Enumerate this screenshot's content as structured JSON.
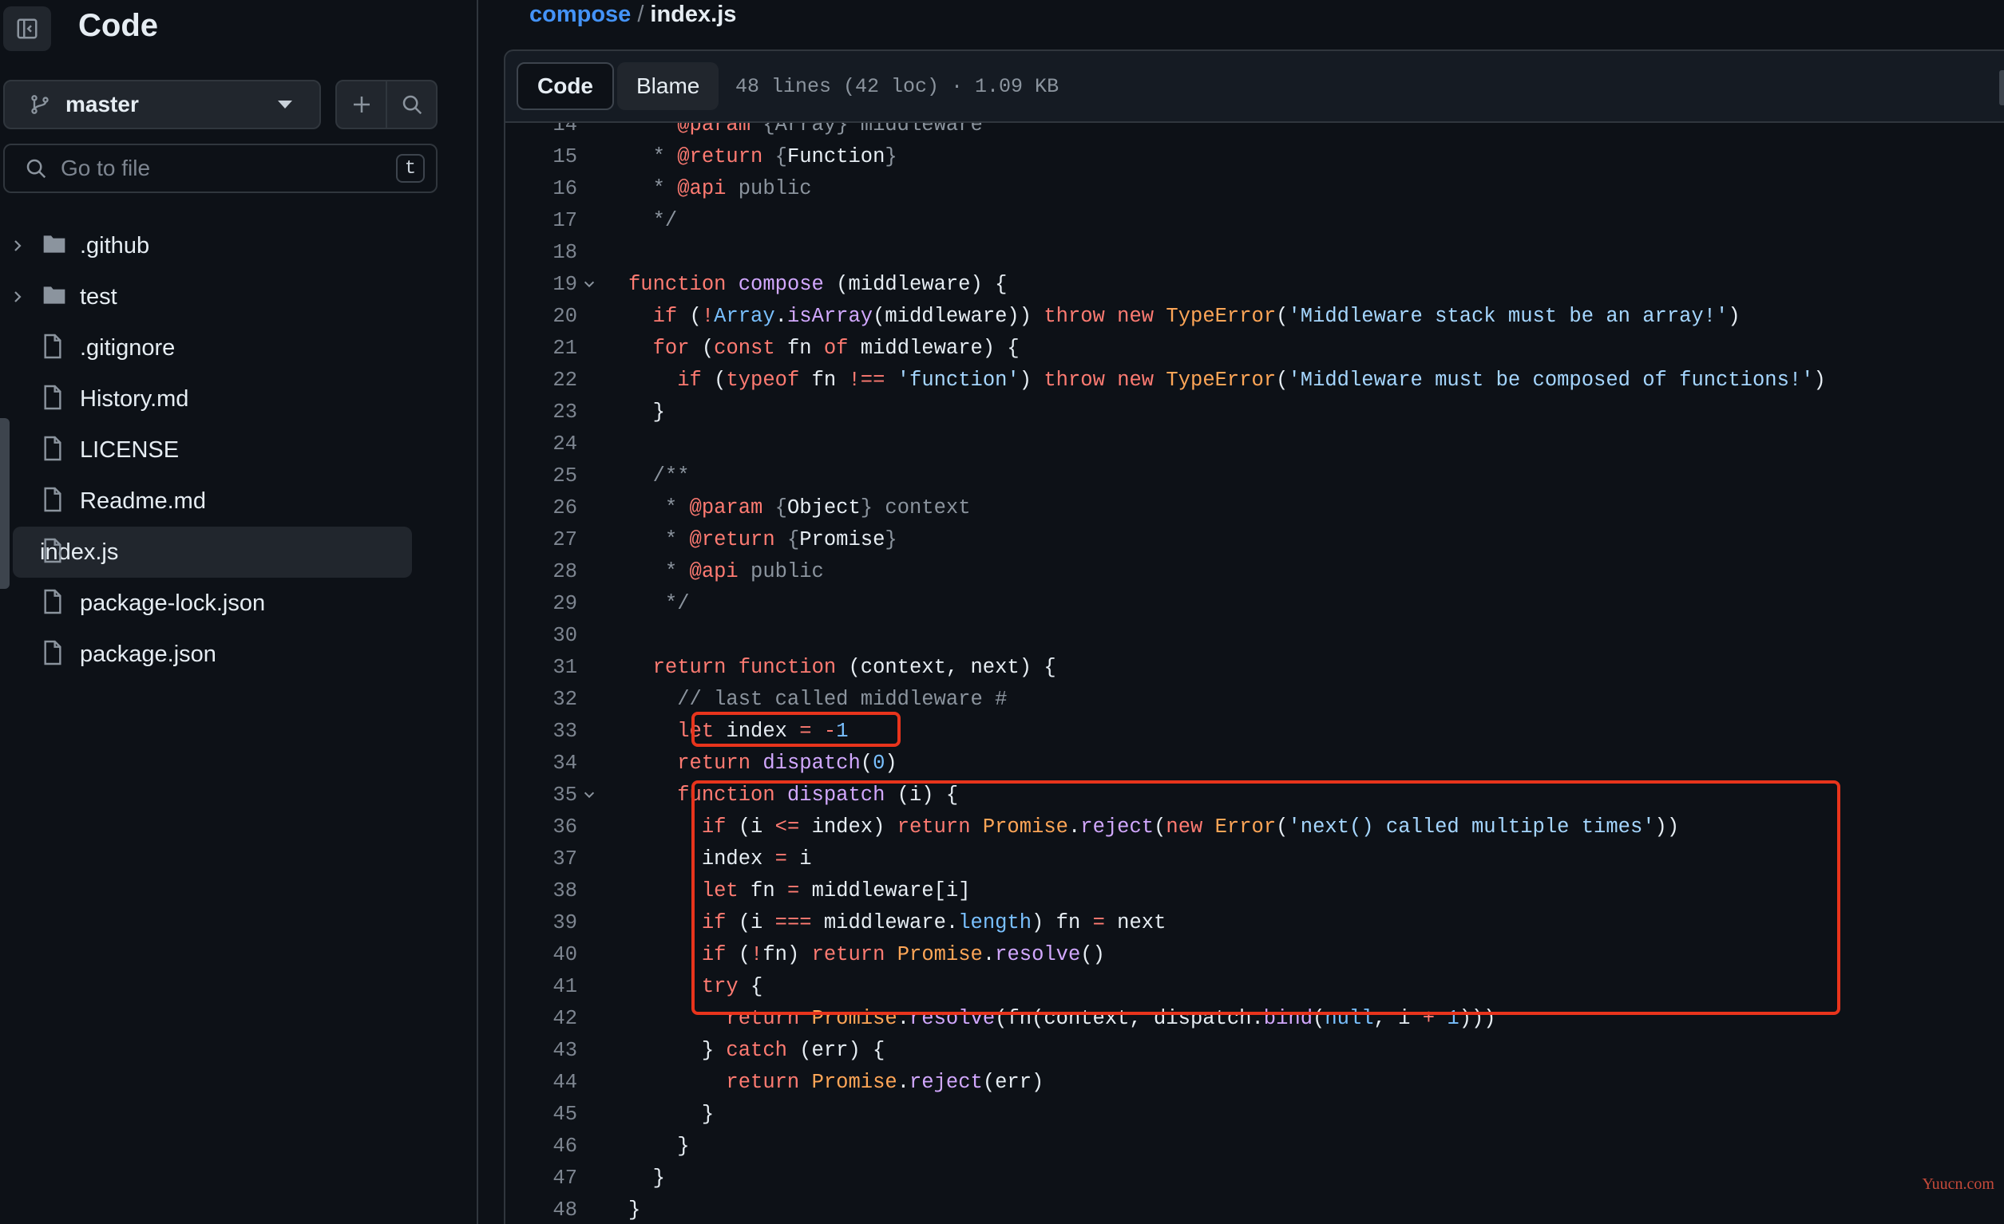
{
  "sidebar": {
    "title": "Code",
    "branch": "master",
    "goto_placeholder": "Go to file",
    "goto_shortcut": "t",
    "items": [
      {
        "name": ".github",
        "type": "folder",
        "expandable": true
      },
      {
        "name": "test",
        "type": "folder",
        "expandable": true
      },
      {
        "name": ".gitignore",
        "type": "file"
      },
      {
        "name": "History.md",
        "type": "file"
      },
      {
        "name": "LICENSE",
        "type": "file"
      },
      {
        "name": "Readme.md",
        "type": "file"
      },
      {
        "name": "index.js",
        "type": "file",
        "selected": true
      },
      {
        "name": "package-lock.json",
        "type": "file"
      },
      {
        "name": "package.json",
        "type": "file"
      }
    ]
  },
  "breadcrumb": {
    "repo": "compose",
    "separator": "/",
    "file": "index.js"
  },
  "file_header": {
    "tabs": [
      "Code",
      "Blame"
    ],
    "active_tab": "Code",
    "meta": "48 lines (42 loc) · 1.09 KB"
  },
  "code": {
    "lines": [
      {
        "n": "14",
        "tokens": [
          [
            "cm",
            "  * "
          ],
          [
            "kw",
            "@param"
          ],
          [
            "cm",
            " {Array} middleware"
          ]
        ]
      },
      {
        "n": "15",
        "tokens": [
          [
            "cm",
            "  * "
          ],
          [
            "kw",
            "@return"
          ],
          [
            "cm",
            " {"
          ],
          [
            "pl",
            "Function"
          ],
          [
            "cm",
            "}"
          ]
        ]
      },
      {
        "n": "16",
        "tokens": [
          [
            "cm",
            "  * "
          ],
          [
            "kw",
            "@api"
          ],
          [
            "cm",
            " public"
          ]
        ]
      },
      {
        "n": "17",
        "tokens": [
          [
            "cm",
            "  */"
          ]
        ]
      },
      {
        "n": "18",
        "tokens": []
      },
      {
        "n": "19",
        "fold": true,
        "tokens": [
          [
            "kw",
            "function"
          ],
          [
            "pl",
            " "
          ],
          [
            "fn",
            "compose"
          ],
          [
            "pl",
            " (middleware) {"
          ]
        ]
      },
      {
        "n": "20",
        "tokens": [
          [
            "pl",
            "  "
          ],
          [
            "kw",
            "if"
          ],
          [
            "pl",
            " ("
          ],
          [
            "kw",
            "!"
          ],
          [
            "c",
            "Array"
          ],
          [
            "pl",
            "."
          ],
          [
            "fn",
            "isArray"
          ],
          [
            "pl",
            "(middleware)) "
          ],
          [
            "kw",
            "throw"
          ],
          [
            "pl",
            " "
          ],
          [
            "kw",
            "new"
          ],
          [
            "pl",
            " "
          ],
          [
            "cls",
            "TypeError"
          ],
          [
            "pl",
            "("
          ],
          [
            "str",
            "'Middleware stack must be an array!'"
          ],
          [
            "pl",
            ")"
          ]
        ]
      },
      {
        "n": "21",
        "tokens": [
          [
            "pl",
            "  "
          ],
          [
            "kw",
            "for"
          ],
          [
            "pl",
            " ("
          ],
          [
            "kw",
            "const"
          ],
          [
            "pl",
            " fn "
          ],
          [
            "kw",
            "of"
          ],
          [
            "pl",
            " middleware) {"
          ]
        ]
      },
      {
        "n": "22",
        "tokens": [
          [
            "pl",
            "    "
          ],
          [
            "kw",
            "if"
          ],
          [
            "pl",
            " ("
          ],
          [
            "kw",
            "typeof"
          ],
          [
            "pl",
            " fn "
          ],
          [
            "kw",
            "!=="
          ],
          [
            "pl",
            " "
          ],
          [
            "str",
            "'function'"
          ],
          [
            "pl",
            ") "
          ],
          [
            "kw",
            "throw"
          ],
          [
            "pl",
            " "
          ],
          [
            "kw",
            "new"
          ],
          [
            "pl",
            " "
          ],
          [
            "cls",
            "TypeError"
          ],
          [
            "pl",
            "("
          ],
          [
            "str",
            "'Middleware must be composed of functions!'"
          ],
          [
            "pl",
            ")"
          ]
        ]
      },
      {
        "n": "23",
        "tokens": [
          [
            "pl",
            "  }"
          ]
        ]
      },
      {
        "n": "24",
        "tokens": []
      },
      {
        "n": "25",
        "tokens": [
          [
            "cm",
            "  /**"
          ]
        ]
      },
      {
        "n": "26",
        "tokens": [
          [
            "cm",
            "   * "
          ],
          [
            "kw",
            "@param"
          ],
          [
            "cm",
            " {"
          ],
          [
            "pl",
            "Object"
          ],
          [
            "cm",
            "} context"
          ]
        ]
      },
      {
        "n": "27",
        "tokens": [
          [
            "cm",
            "   * "
          ],
          [
            "kw",
            "@return"
          ],
          [
            "cm",
            " {"
          ],
          [
            "pl",
            "Promise"
          ],
          [
            "cm",
            "}"
          ]
        ]
      },
      {
        "n": "28",
        "tokens": [
          [
            "cm",
            "   * "
          ],
          [
            "kw",
            "@api"
          ],
          [
            "cm",
            " public"
          ]
        ]
      },
      {
        "n": "29",
        "tokens": [
          [
            "cm",
            "   */"
          ]
        ]
      },
      {
        "n": "30",
        "tokens": []
      },
      {
        "n": "31",
        "tokens": [
          [
            "pl",
            "  "
          ],
          [
            "kw",
            "return"
          ],
          [
            "pl",
            " "
          ],
          [
            "kw",
            "function"
          ],
          [
            "pl",
            " (context, next) {"
          ]
        ]
      },
      {
        "n": "32",
        "tokens": [
          [
            "cm",
            "    // last called middleware #"
          ]
        ]
      },
      {
        "n": "33",
        "tokens": [
          [
            "pl",
            "    "
          ],
          [
            "kw",
            "let"
          ],
          [
            "pl",
            " index "
          ],
          [
            "kw",
            "="
          ],
          [
            "pl",
            " "
          ],
          [
            "kw",
            "-"
          ],
          [
            "c",
            "1"
          ]
        ]
      },
      {
        "n": "34",
        "tokens": [
          [
            "pl",
            "    "
          ],
          [
            "kw",
            "return"
          ],
          [
            "pl",
            " "
          ],
          [
            "fn",
            "dispatch"
          ],
          [
            "pl",
            "("
          ],
          [
            "c",
            "0"
          ],
          [
            "pl",
            ")"
          ]
        ]
      },
      {
        "n": "35",
        "fold": true,
        "tokens": [
          [
            "pl",
            "    "
          ],
          [
            "kw",
            "function"
          ],
          [
            "pl",
            " "
          ],
          [
            "fn",
            "dispatch"
          ],
          [
            "pl",
            " (i) {"
          ]
        ]
      },
      {
        "n": "36",
        "tokens": [
          [
            "pl",
            "      "
          ],
          [
            "kw",
            "if"
          ],
          [
            "pl",
            " (i "
          ],
          [
            "kw",
            "<="
          ],
          [
            "pl",
            " index) "
          ],
          [
            "kw",
            "return"
          ],
          [
            "pl",
            " "
          ],
          [
            "cls",
            "Promise"
          ],
          [
            "pl",
            "."
          ],
          [
            "fn",
            "reject"
          ],
          [
            "pl",
            "("
          ],
          [
            "kw",
            "new"
          ],
          [
            "pl",
            " "
          ],
          [
            "cls",
            "Error"
          ],
          [
            "pl",
            "("
          ],
          [
            "str",
            "'next() called multiple times'"
          ],
          [
            "pl",
            "))"
          ]
        ]
      },
      {
        "n": "37",
        "tokens": [
          [
            "pl",
            "      index "
          ],
          [
            "kw",
            "="
          ],
          [
            "pl",
            " i"
          ]
        ]
      },
      {
        "n": "38",
        "tokens": [
          [
            "pl",
            "      "
          ],
          [
            "kw",
            "let"
          ],
          [
            "pl",
            " fn "
          ],
          [
            "kw",
            "="
          ],
          [
            "pl",
            " middleware[i]"
          ]
        ]
      },
      {
        "n": "39",
        "tokens": [
          [
            "pl",
            "      "
          ],
          [
            "kw",
            "if"
          ],
          [
            "pl",
            " (i "
          ],
          [
            "kw",
            "==="
          ],
          [
            "pl",
            " middleware."
          ],
          [
            "c",
            "length"
          ],
          [
            "pl",
            ") fn "
          ],
          [
            "kw",
            "="
          ],
          [
            "pl",
            " next"
          ]
        ]
      },
      {
        "n": "40",
        "tokens": [
          [
            "pl",
            "      "
          ],
          [
            "kw",
            "if"
          ],
          [
            "pl",
            " ("
          ],
          [
            "kw",
            "!"
          ],
          [
            "pl",
            "fn) "
          ],
          [
            "kw",
            "return"
          ],
          [
            "pl",
            " "
          ],
          [
            "cls",
            "Promise"
          ],
          [
            "pl",
            "."
          ],
          [
            "fn",
            "resolve"
          ],
          [
            "pl",
            "()"
          ]
        ]
      },
      {
        "n": "41",
        "tokens": [
          [
            "pl",
            "      "
          ],
          [
            "kw",
            "try"
          ],
          [
            "pl",
            " {"
          ]
        ]
      },
      {
        "n": "42",
        "tokens": [
          [
            "pl",
            "        "
          ],
          [
            "kw",
            "return"
          ],
          [
            "pl",
            " "
          ],
          [
            "cls",
            "Promise"
          ],
          [
            "pl",
            "."
          ],
          [
            "fn",
            "resolve"
          ],
          [
            "pl",
            "(fn(context, dispatch."
          ],
          [
            "fn",
            "bind"
          ],
          [
            "pl",
            "("
          ],
          [
            "c",
            "null"
          ],
          [
            "pl",
            ", i "
          ],
          [
            "kw",
            "+"
          ],
          [
            "pl",
            " "
          ],
          [
            "c",
            "1"
          ],
          [
            "pl",
            ")))"
          ]
        ]
      },
      {
        "n": "43",
        "tokens": [
          [
            "pl",
            "      } "
          ],
          [
            "kw",
            "catch"
          ],
          [
            "pl",
            " (err) {"
          ]
        ]
      },
      {
        "n": "44",
        "tokens": [
          [
            "pl",
            "        "
          ],
          [
            "kw",
            "return"
          ],
          [
            "pl",
            " "
          ],
          [
            "cls",
            "Promise"
          ],
          [
            "pl",
            "."
          ],
          [
            "fn",
            "reject"
          ],
          [
            "pl",
            "(err)"
          ]
        ]
      },
      {
        "n": "45",
        "tokens": [
          [
            "pl",
            "      }"
          ]
        ]
      },
      {
        "n": "46",
        "tokens": [
          [
            "pl",
            "    }"
          ]
        ]
      },
      {
        "n": "47",
        "tokens": [
          [
            "pl",
            "  }"
          ]
        ]
      },
      {
        "n": "48",
        "tokens": [
          [
            "pl",
            "}"
          ]
        ]
      }
    ]
  },
  "watermark": "Yuucn.com",
  "colors": {
    "keyword": "#ff7b72",
    "function": "#d2a8ff",
    "string": "#a5d6ff",
    "comment": "#8b949e",
    "constant": "#79c0ff",
    "class": "#ffa657",
    "highlight_box": "#e8341c",
    "link": "#4493f8"
  }
}
